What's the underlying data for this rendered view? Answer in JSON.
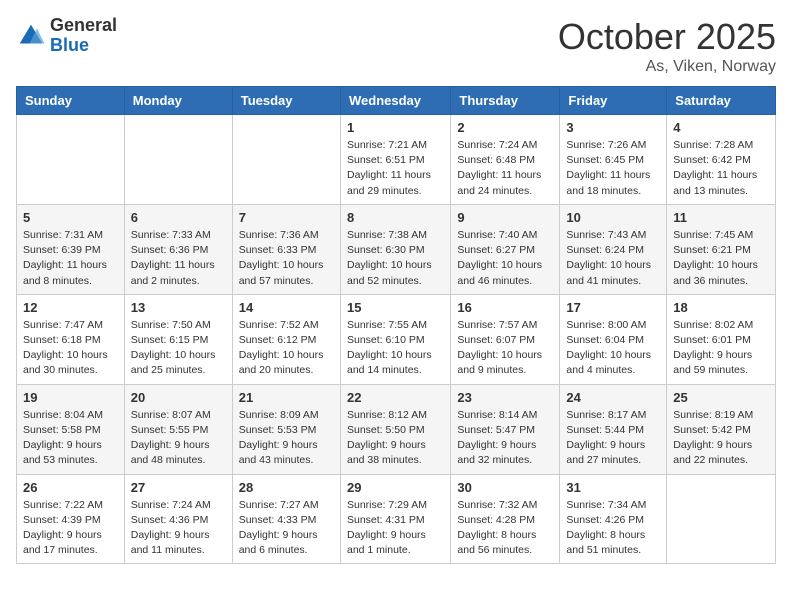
{
  "logo": {
    "general": "General",
    "blue": "Blue"
  },
  "title": "October 2025",
  "location": "As, Viken, Norway",
  "days_of_week": [
    "Sunday",
    "Monday",
    "Tuesday",
    "Wednesday",
    "Thursday",
    "Friday",
    "Saturday"
  ],
  "weeks": [
    [
      {
        "day": "",
        "info": ""
      },
      {
        "day": "",
        "info": ""
      },
      {
        "day": "",
        "info": ""
      },
      {
        "day": "1",
        "info": "Sunrise: 7:21 AM\nSunset: 6:51 PM\nDaylight: 11 hours\nand 29 minutes."
      },
      {
        "day": "2",
        "info": "Sunrise: 7:24 AM\nSunset: 6:48 PM\nDaylight: 11 hours\nand 24 minutes."
      },
      {
        "day": "3",
        "info": "Sunrise: 7:26 AM\nSunset: 6:45 PM\nDaylight: 11 hours\nand 18 minutes."
      },
      {
        "day": "4",
        "info": "Sunrise: 7:28 AM\nSunset: 6:42 PM\nDaylight: 11 hours\nand 13 minutes."
      }
    ],
    [
      {
        "day": "5",
        "info": "Sunrise: 7:31 AM\nSunset: 6:39 PM\nDaylight: 11 hours\nand 8 minutes."
      },
      {
        "day": "6",
        "info": "Sunrise: 7:33 AM\nSunset: 6:36 PM\nDaylight: 11 hours\nand 2 minutes."
      },
      {
        "day": "7",
        "info": "Sunrise: 7:36 AM\nSunset: 6:33 PM\nDaylight: 10 hours\nand 57 minutes."
      },
      {
        "day": "8",
        "info": "Sunrise: 7:38 AM\nSunset: 6:30 PM\nDaylight: 10 hours\nand 52 minutes."
      },
      {
        "day": "9",
        "info": "Sunrise: 7:40 AM\nSunset: 6:27 PM\nDaylight: 10 hours\nand 46 minutes."
      },
      {
        "day": "10",
        "info": "Sunrise: 7:43 AM\nSunset: 6:24 PM\nDaylight: 10 hours\nand 41 minutes."
      },
      {
        "day": "11",
        "info": "Sunrise: 7:45 AM\nSunset: 6:21 PM\nDaylight: 10 hours\nand 36 minutes."
      }
    ],
    [
      {
        "day": "12",
        "info": "Sunrise: 7:47 AM\nSunset: 6:18 PM\nDaylight: 10 hours\nand 30 minutes."
      },
      {
        "day": "13",
        "info": "Sunrise: 7:50 AM\nSunset: 6:15 PM\nDaylight: 10 hours\nand 25 minutes."
      },
      {
        "day": "14",
        "info": "Sunrise: 7:52 AM\nSunset: 6:12 PM\nDaylight: 10 hours\nand 20 minutes."
      },
      {
        "day": "15",
        "info": "Sunrise: 7:55 AM\nSunset: 6:10 PM\nDaylight: 10 hours\nand 14 minutes."
      },
      {
        "day": "16",
        "info": "Sunrise: 7:57 AM\nSunset: 6:07 PM\nDaylight: 10 hours\nand 9 minutes."
      },
      {
        "day": "17",
        "info": "Sunrise: 8:00 AM\nSunset: 6:04 PM\nDaylight: 10 hours\nand 4 minutes."
      },
      {
        "day": "18",
        "info": "Sunrise: 8:02 AM\nSunset: 6:01 PM\nDaylight: 9 hours\nand 59 minutes."
      }
    ],
    [
      {
        "day": "19",
        "info": "Sunrise: 8:04 AM\nSunset: 5:58 PM\nDaylight: 9 hours\nand 53 minutes."
      },
      {
        "day": "20",
        "info": "Sunrise: 8:07 AM\nSunset: 5:55 PM\nDaylight: 9 hours\nand 48 minutes."
      },
      {
        "day": "21",
        "info": "Sunrise: 8:09 AM\nSunset: 5:53 PM\nDaylight: 9 hours\nand 43 minutes."
      },
      {
        "day": "22",
        "info": "Sunrise: 8:12 AM\nSunset: 5:50 PM\nDaylight: 9 hours\nand 38 minutes."
      },
      {
        "day": "23",
        "info": "Sunrise: 8:14 AM\nSunset: 5:47 PM\nDaylight: 9 hours\nand 32 minutes."
      },
      {
        "day": "24",
        "info": "Sunrise: 8:17 AM\nSunset: 5:44 PM\nDaylight: 9 hours\nand 27 minutes."
      },
      {
        "day": "25",
        "info": "Sunrise: 8:19 AM\nSunset: 5:42 PM\nDaylight: 9 hours\nand 22 minutes."
      }
    ],
    [
      {
        "day": "26",
        "info": "Sunrise: 7:22 AM\nSunset: 4:39 PM\nDaylight: 9 hours\nand 17 minutes."
      },
      {
        "day": "27",
        "info": "Sunrise: 7:24 AM\nSunset: 4:36 PM\nDaylight: 9 hours\nand 11 minutes."
      },
      {
        "day": "28",
        "info": "Sunrise: 7:27 AM\nSunset: 4:33 PM\nDaylight: 9 hours\nand 6 minutes."
      },
      {
        "day": "29",
        "info": "Sunrise: 7:29 AM\nSunset: 4:31 PM\nDaylight: 9 hours\nand 1 minute."
      },
      {
        "day": "30",
        "info": "Sunrise: 7:32 AM\nSunset: 4:28 PM\nDaylight: 8 hours\nand 56 minutes."
      },
      {
        "day": "31",
        "info": "Sunrise: 7:34 AM\nSunset: 4:26 PM\nDaylight: 8 hours\nand 51 minutes."
      },
      {
        "day": "",
        "info": ""
      }
    ]
  ]
}
